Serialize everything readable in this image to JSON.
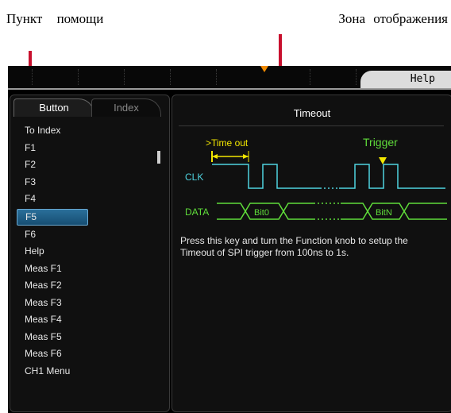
{
  "annotations": {
    "left": "Пункт помощи",
    "right": "Зона отображения"
  },
  "topbar": {
    "help_label": "Help"
  },
  "left_panel": {
    "tabs": [
      {
        "label": "Button"
      },
      {
        "label": "Index"
      }
    ],
    "items": [
      {
        "label": "To Index"
      },
      {
        "label": "F1"
      },
      {
        "label": "F2"
      },
      {
        "label": "F3"
      },
      {
        "label": "F4"
      },
      {
        "label": "F5"
      },
      {
        "label": "F6"
      },
      {
        "label": "Help"
      },
      {
        "label": "Meas F1"
      },
      {
        "label": "Meas F2"
      },
      {
        "label": "Meas F3"
      },
      {
        "label": "Meas F4"
      },
      {
        "label": "Meas F5"
      },
      {
        "label": "Meas F6"
      },
      {
        "label": "CH1 Menu"
      }
    ],
    "selected_item": "F5"
  },
  "right_panel": {
    "title": "Timeout",
    "diagram": {
      "timeout_label": ">Time out",
      "trigger_label": "Trigger",
      "clk_label": "CLK",
      "data_label": "DATA",
      "bit0_label": "Bit0",
      "bitn_label": "BitN"
    },
    "description": "Press this key and turn the Function knob to setup the Timeout of SPI trigger from 100ns to 1s."
  },
  "colors": {
    "accent_red": "#c8102e",
    "clk": "#4fd4e0",
    "data": "#5fdc3a",
    "timeout": "#f2e600",
    "trigger": "#5fdc3a",
    "selection": "#1f5f88"
  }
}
